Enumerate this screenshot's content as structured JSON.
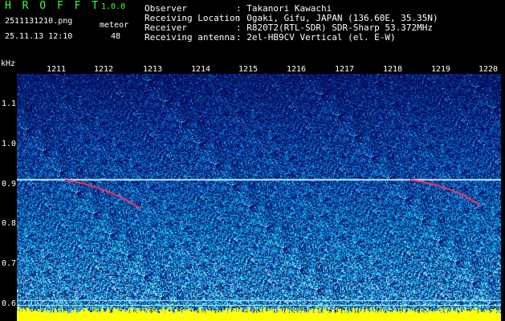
{
  "header": {
    "app_title": "H R O F F T",
    "version": "1.0.0",
    "file_name": "2511131210.png",
    "meteor_label": "meteor",
    "meteor_count": "48",
    "datetime": "25.11.13 12:10"
  },
  "info": [
    {
      "key": "Observer",
      "value": ": Takanori Kawachi"
    },
    {
      "key": "Receiving Location",
      "value": ": Ogaki, Gifu, JAPAN (136.60E, 35.35N)"
    },
    {
      "key": "Receiver",
      "value": ": R820T2(RTL-SDR) SDR-Sharp 53.372MHz"
    },
    {
      "key": "Receiving antenna",
      "value": ": 2el-HB9CV Vertical (el. E-W)"
    }
  ],
  "axes": {
    "y_unit": "kHz",
    "x_ticks": [
      "1211",
      "1212",
      "1213",
      "1214",
      "1215",
      "1216",
      "1217",
      "1218",
      "1219",
      "1220"
    ],
    "y_ticks": [
      "1.1",
      "1.0",
      "0.9",
      "0.8",
      "0.7",
      "0.6"
    ]
  },
  "colors": {
    "background": "#000000",
    "spectrum_low": "#10208a",
    "spectrum_mid": "#1fa0ff",
    "spectrum_high": "#ffffff",
    "meteor_trace": "#ff3060",
    "bottom_bar": "#ffff00",
    "header_accent": "#40ff40"
  }
}
